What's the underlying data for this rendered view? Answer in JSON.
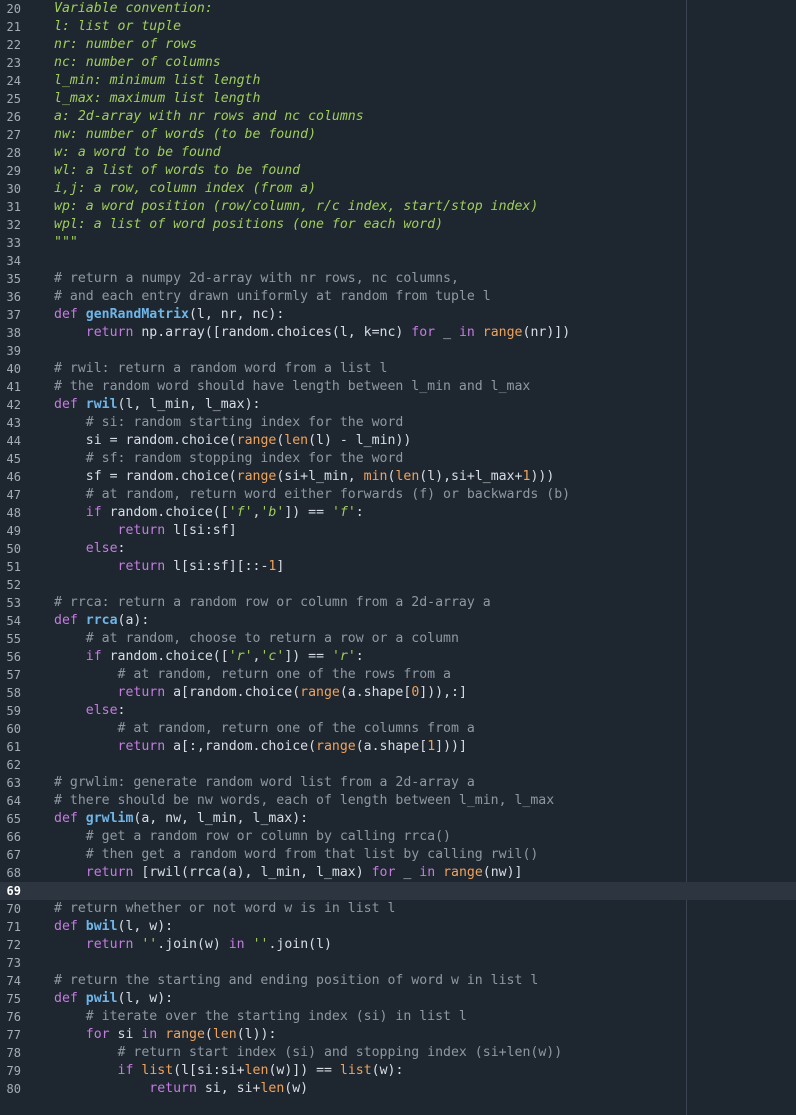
{
  "editor": {
    "current_line": 69,
    "lines": [
      {
        "n": "20",
        "tokens": [
          {
            "t": "Variable convention:",
            "c": "doc"
          }
        ]
      },
      {
        "n": "21",
        "tokens": [
          {
            "t": "l: list or tuple",
            "c": "doc"
          }
        ]
      },
      {
        "n": "22",
        "tokens": [
          {
            "t": "nr: number of rows",
            "c": "doc"
          }
        ]
      },
      {
        "n": "23",
        "tokens": [
          {
            "t": "nc: number of columns",
            "c": "doc"
          }
        ]
      },
      {
        "n": "24",
        "tokens": [
          {
            "t": "l_min: minimum list length",
            "c": "doc"
          }
        ]
      },
      {
        "n": "25",
        "tokens": [
          {
            "t": "l_max: maximum list length",
            "c": "doc"
          }
        ]
      },
      {
        "n": "26",
        "tokens": [
          {
            "t": "a: 2d-array with nr rows and nc columns",
            "c": "doc"
          }
        ]
      },
      {
        "n": "27",
        "tokens": [
          {
            "t": "nw: number of words (to be found)",
            "c": "doc"
          }
        ]
      },
      {
        "n": "28",
        "tokens": [
          {
            "t": "w: a word to be found",
            "c": "doc"
          }
        ]
      },
      {
        "n": "29",
        "tokens": [
          {
            "t": "wl: a list of words to be found",
            "c": "doc"
          }
        ]
      },
      {
        "n": "30",
        "tokens": [
          {
            "t": "i,j: a row, column index (from a)",
            "c": "doc"
          }
        ]
      },
      {
        "n": "31",
        "tokens": [
          {
            "t": "wp: a word position (row/column, r/c index, start/stop index)",
            "c": "doc"
          }
        ]
      },
      {
        "n": "32",
        "tokens": [
          {
            "t": "wpl: a list of word positions (one for each word)",
            "c": "doc"
          }
        ]
      },
      {
        "n": "33",
        "tokens": [
          {
            "t": "\"\"\"",
            "c": "doc"
          }
        ]
      },
      {
        "n": "34",
        "tokens": []
      },
      {
        "n": "35",
        "tokens": [
          {
            "t": "# return a numpy 2d-array with nr rows, nc columns,",
            "c": "comment"
          }
        ]
      },
      {
        "n": "36",
        "tokens": [
          {
            "t": "# and each entry drawn uniformly at random from tuple l",
            "c": "comment"
          }
        ]
      },
      {
        "n": "37",
        "tokens": [
          {
            "t": "def ",
            "c": "kw"
          },
          {
            "t": "genRandMatrix",
            "c": "fn"
          },
          {
            "t": "(l, nr, nc):",
            "c": "plain"
          }
        ]
      },
      {
        "n": "38",
        "tokens": [
          {
            "t": "    ",
            "c": "plain"
          },
          {
            "t": "return",
            "c": "kw"
          },
          {
            "t": " np.array([random.choices(l, k=nc) ",
            "c": "plain"
          },
          {
            "t": "for",
            "c": "kw"
          },
          {
            "t": " _ ",
            "c": "plain"
          },
          {
            "t": "in",
            "c": "kw"
          },
          {
            "t": " ",
            "c": "plain"
          },
          {
            "t": "range",
            "c": "builtin"
          },
          {
            "t": "(nr)])",
            "c": "plain"
          }
        ]
      },
      {
        "n": "39",
        "tokens": []
      },
      {
        "n": "40",
        "tokens": [
          {
            "t": "# rwil: return a random word from a list l",
            "c": "comment"
          }
        ]
      },
      {
        "n": "41",
        "tokens": [
          {
            "t": "# the random word should have length between l_min and l_max",
            "c": "comment"
          }
        ]
      },
      {
        "n": "42",
        "tokens": [
          {
            "t": "def ",
            "c": "kw"
          },
          {
            "t": "rwil",
            "c": "fn"
          },
          {
            "t": "(l, l_min, l_max):",
            "c": "plain"
          }
        ]
      },
      {
        "n": "43",
        "tokens": [
          {
            "t": "    ",
            "c": "plain"
          },
          {
            "t": "# si: random starting index for the word",
            "c": "comment"
          }
        ]
      },
      {
        "n": "44",
        "tokens": [
          {
            "t": "    si = random.choice(",
            "c": "plain"
          },
          {
            "t": "range",
            "c": "builtin"
          },
          {
            "t": "(",
            "c": "plain"
          },
          {
            "t": "len",
            "c": "builtin"
          },
          {
            "t": "(l) - l_min))",
            "c": "plain"
          }
        ]
      },
      {
        "n": "45",
        "tokens": [
          {
            "t": "    ",
            "c": "plain"
          },
          {
            "t": "# sf: random stopping index for the word",
            "c": "comment"
          }
        ]
      },
      {
        "n": "46",
        "tokens": [
          {
            "t": "    sf = random.choice(",
            "c": "plain"
          },
          {
            "t": "range",
            "c": "builtin"
          },
          {
            "t": "(si+l_min, ",
            "c": "plain"
          },
          {
            "t": "min",
            "c": "builtin"
          },
          {
            "t": "(",
            "c": "plain"
          },
          {
            "t": "len",
            "c": "builtin"
          },
          {
            "t": "(l),si+l_max+",
            "c": "plain"
          },
          {
            "t": "1",
            "c": "num"
          },
          {
            "t": ")))",
            "c": "plain"
          }
        ]
      },
      {
        "n": "47",
        "tokens": [
          {
            "t": "    ",
            "c": "plain"
          },
          {
            "t": "# at random, return word either forwards (f) or backwards (b)",
            "c": "comment"
          }
        ]
      },
      {
        "n": "48",
        "tokens": [
          {
            "t": "    ",
            "c": "plain"
          },
          {
            "t": "if",
            "c": "kw"
          },
          {
            "t": " random.choice([",
            "c": "plain"
          },
          {
            "t": "'f'",
            "c": "str"
          },
          {
            "t": ",",
            "c": "plain"
          },
          {
            "t": "'b'",
            "c": "str"
          },
          {
            "t": "]) == ",
            "c": "plain"
          },
          {
            "t": "'f'",
            "c": "str"
          },
          {
            "t": ":",
            "c": "plain"
          }
        ]
      },
      {
        "n": "49",
        "tokens": [
          {
            "t": "        ",
            "c": "plain"
          },
          {
            "t": "return",
            "c": "kw"
          },
          {
            "t": " l[si:sf]",
            "c": "plain"
          }
        ]
      },
      {
        "n": "50",
        "tokens": [
          {
            "t": "    ",
            "c": "plain"
          },
          {
            "t": "else",
            "c": "kw"
          },
          {
            "t": ":",
            "c": "plain"
          }
        ]
      },
      {
        "n": "51",
        "tokens": [
          {
            "t": "        ",
            "c": "plain"
          },
          {
            "t": "return",
            "c": "kw"
          },
          {
            "t": " l[si:sf][::-",
            "c": "plain"
          },
          {
            "t": "1",
            "c": "num"
          },
          {
            "t": "]",
            "c": "plain"
          }
        ]
      },
      {
        "n": "52",
        "tokens": []
      },
      {
        "n": "53",
        "tokens": [
          {
            "t": "# rrca: return a random row or column from a 2d-array a",
            "c": "comment"
          }
        ]
      },
      {
        "n": "54",
        "tokens": [
          {
            "t": "def ",
            "c": "kw"
          },
          {
            "t": "rrca",
            "c": "fn"
          },
          {
            "t": "(a):",
            "c": "plain"
          }
        ]
      },
      {
        "n": "55",
        "tokens": [
          {
            "t": "    ",
            "c": "plain"
          },
          {
            "t": "# at random, choose to return a row or a column",
            "c": "comment"
          }
        ]
      },
      {
        "n": "56",
        "tokens": [
          {
            "t": "    ",
            "c": "plain"
          },
          {
            "t": "if",
            "c": "kw"
          },
          {
            "t": " random.choice([",
            "c": "plain"
          },
          {
            "t": "'r'",
            "c": "str"
          },
          {
            "t": ",",
            "c": "plain"
          },
          {
            "t": "'c'",
            "c": "str"
          },
          {
            "t": "]) == ",
            "c": "plain"
          },
          {
            "t": "'r'",
            "c": "str"
          },
          {
            "t": ":",
            "c": "plain"
          }
        ]
      },
      {
        "n": "57",
        "tokens": [
          {
            "t": "        ",
            "c": "plain"
          },
          {
            "t": "# at random, return one of the rows from a",
            "c": "comment"
          }
        ]
      },
      {
        "n": "58",
        "tokens": [
          {
            "t": "        ",
            "c": "plain"
          },
          {
            "t": "return",
            "c": "kw"
          },
          {
            "t": " a[random.choice(",
            "c": "plain"
          },
          {
            "t": "range",
            "c": "builtin"
          },
          {
            "t": "(a.shape[",
            "c": "plain"
          },
          {
            "t": "0",
            "c": "num"
          },
          {
            "t": "])),:]",
            "c": "plain"
          }
        ]
      },
      {
        "n": "59",
        "tokens": [
          {
            "t": "    ",
            "c": "plain"
          },
          {
            "t": "else",
            "c": "kw"
          },
          {
            "t": ":",
            "c": "plain"
          }
        ]
      },
      {
        "n": "60",
        "tokens": [
          {
            "t": "        ",
            "c": "plain"
          },
          {
            "t": "# at random, return one of the columns from a",
            "c": "comment"
          }
        ]
      },
      {
        "n": "61",
        "tokens": [
          {
            "t": "        ",
            "c": "plain"
          },
          {
            "t": "return",
            "c": "kw"
          },
          {
            "t": " a[:,random.choice(",
            "c": "plain"
          },
          {
            "t": "range",
            "c": "builtin"
          },
          {
            "t": "(a.shape[",
            "c": "plain"
          },
          {
            "t": "1",
            "c": "num"
          },
          {
            "t": "]))]",
            "c": "plain"
          }
        ]
      },
      {
        "n": "62",
        "tokens": []
      },
      {
        "n": "63",
        "tokens": [
          {
            "t": "# grwlim: generate random word list from a 2d-array a",
            "c": "comment"
          }
        ]
      },
      {
        "n": "64",
        "tokens": [
          {
            "t": "# there should be nw words, each of length between l_min, l_max",
            "c": "comment"
          }
        ]
      },
      {
        "n": "65",
        "tokens": [
          {
            "t": "def ",
            "c": "kw"
          },
          {
            "t": "grwlim",
            "c": "fn"
          },
          {
            "t": "(a, nw, l_min, l_max):",
            "c": "plain"
          }
        ]
      },
      {
        "n": "66",
        "tokens": [
          {
            "t": "    ",
            "c": "plain"
          },
          {
            "t": "# get a random row or column by calling rrca()",
            "c": "comment"
          }
        ]
      },
      {
        "n": "67",
        "tokens": [
          {
            "t": "    ",
            "c": "plain"
          },
          {
            "t": "# then get a random word from that list by calling rwil()",
            "c": "comment"
          }
        ]
      },
      {
        "n": "68",
        "tokens": [
          {
            "t": "    ",
            "c": "plain"
          },
          {
            "t": "return",
            "c": "kw"
          },
          {
            "t": " [rwil(rrca(a), l_min, l_max) ",
            "c": "plain"
          },
          {
            "t": "for",
            "c": "kw"
          },
          {
            "t": " _ ",
            "c": "plain"
          },
          {
            "t": "in",
            "c": "kw"
          },
          {
            "t": " ",
            "c": "plain"
          },
          {
            "t": "range",
            "c": "builtin"
          },
          {
            "t": "(nw)]",
            "c": "plain"
          }
        ]
      },
      {
        "n": "69",
        "tokens": []
      },
      {
        "n": "70",
        "tokens": [
          {
            "t": "# return whether or not word w is in list l",
            "c": "comment"
          }
        ]
      },
      {
        "n": "71",
        "tokens": [
          {
            "t": "def ",
            "c": "kw"
          },
          {
            "t": "bwil",
            "c": "fn"
          },
          {
            "t": "(l, w):",
            "c": "plain"
          }
        ]
      },
      {
        "n": "72",
        "tokens": [
          {
            "t": "    ",
            "c": "plain"
          },
          {
            "t": "return",
            "c": "kw"
          },
          {
            "t": " ",
            "c": "plain"
          },
          {
            "t": "''",
            "c": "str"
          },
          {
            "t": ".join(w) ",
            "c": "plain"
          },
          {
            "t": "in",
            "c": "kw"
          },
          {
            "t": " ",
            "c": "plain"
          },
          {
            "t": "''",
            "c": "str"
          },
          {
            "t": ".join(l)",
            "c": "plain"
          }
        ]
      },
      {
        "n": "73",
        "tokens": []
      },
      {
        "n": "74",
        "tokens": [
          {
            "t": "# return the starting and ending position of word w in list l",
            "c": "comment"
          }
        ]
      },
      {
        "n": "75",
        "tokens": [
          {
            "t": "def ",
            "c": "kw"
          },
          {
            "t": "pwil",
            "c": "fn"
          },
          {
            "t": "(l, w):",
            "c": "plain"
          }
        ]
      },
      {
        "n": "76",
        "tokens": [
          {
            "t": "    ",
            "c": "plain"
          },
          {
            "t": "# iterate over the starting index (si) in list l",
            "c": "comment"
          }
        ]
      },
      {
        "n": "77",
        "tokens": [
          {
            "t": "    ",
            "c": "plain"
          },
          {
            "t": "for",
            "c": "kw"
          },
          {
            "t": " si ",
            "c": "plain"
          },
          {
            "t": "in",
            "c": "kw"
          },
          {
            "t": " ",
            "c": "plain"
          },
          {
            "t": "range",
            "c": "builtin"
          },
          {
            "t": "(",
            "c": "plain"
          },
          {
            "t": "len",
            "c": "builtin"
          },
          {
            "t": "(l)):",
            "c": "plain"
          }
        ]
      },
      {
        "n": "78",
        "tokens": [
          {
            "t": "        ",
            "c": "plain"
          },
          {
            "t": "# return start index (si) and stopping index (si+len(w))",
            "c": "comment"
          }
        ]
      },
      {
        "n": "79",
        "tokens": [
          {
            "t": "        ",
            "c": "plain"
          },
          {
            "t": "if",
            "c": "kw"
          },
          {
            "t": " ",
            "c": "plain"
          },
          {
            "t": "list",
            "c": "builtin"
          },
          {
            "t": "(l[si:si+",
            "c": "plain"
          },
          {
            "t": "len",
            "c": "builtin"
          },
          {
            "t": "(w)]) == ",
            "c": "plain"
          },
          {
            "t": "list",
            "c": "builtin"
          },
          {
            "t": "(w):",
            "c": "plain"
          }
        ]
      },
      {
        "n": "80",
        "tokens": [
          {
            "t": "            ",
            "c": "plain"
          },
          {
            "t": "return",
            "c": "kw"
          },
          {
            "t": " si, si+",
            "c": "plain"
          },
          {
            "t": "len",
            "c": "builtin"
          },
          {
            "t": "(w)",
            "c": "plain"
          }
        ]
      }
    ]
  }
}
